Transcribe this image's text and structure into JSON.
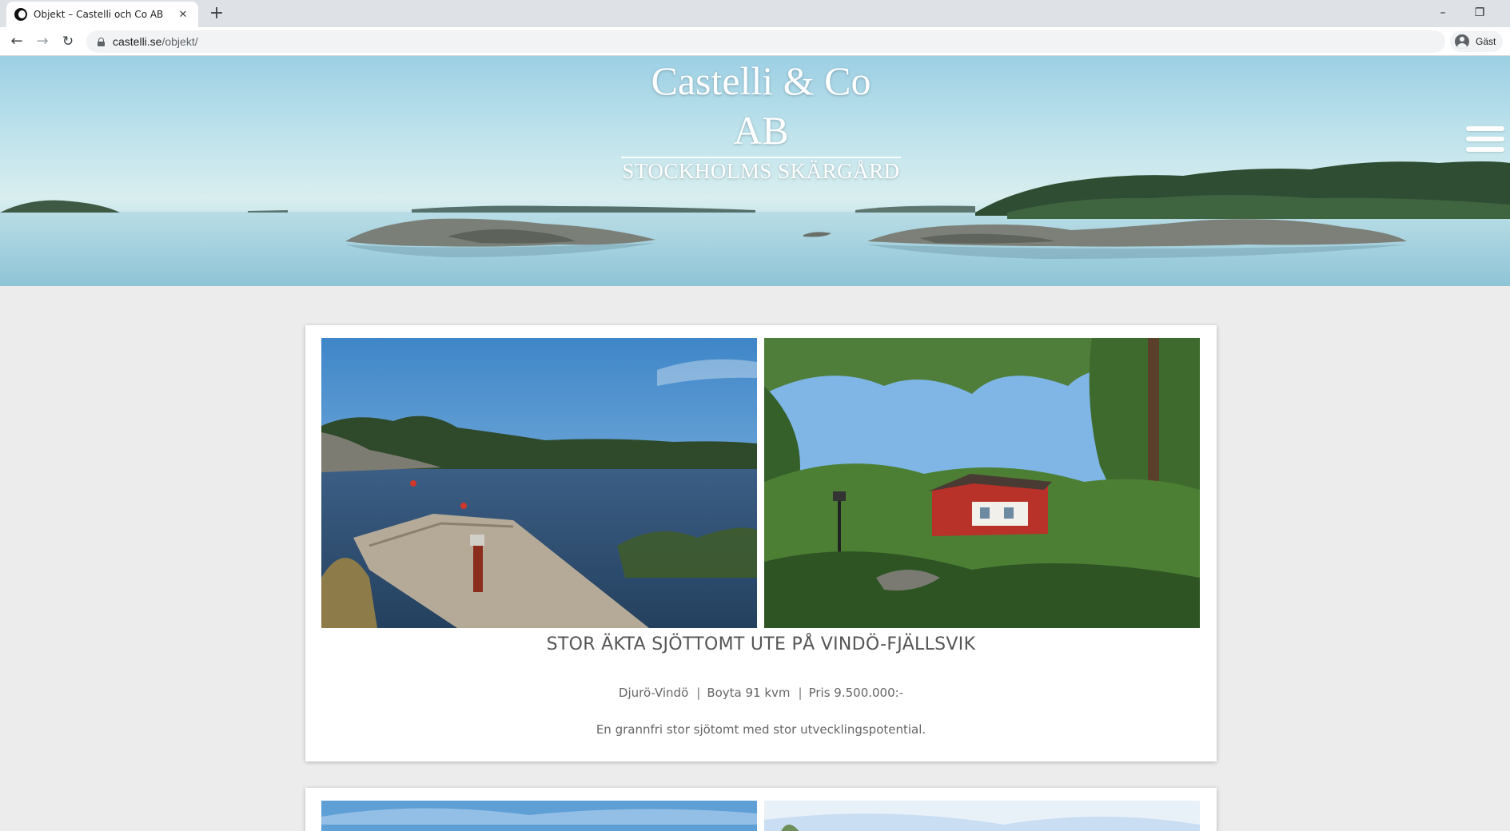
{
  "browser": {
    "tab_title": "Objekt – Castelli och Co AB",
    "tab_close_glyph": "✕",
    "new_tab_glyph": "+",
    "minimize_glyph": "–",
    "restore_glyph": "❐",
    "back_glyph": "←",
    "forward_glyph": "→",
    "reload_glyph": "↻",
    "url_host": "castelli.se",
    "url_path": "/objekt/",
    "profile_label": "Gäst"
  },
  "header": {
    "brand_name": "Castelli & Co AB",
    "brand_subtitle": "STOCKHOLMS SKÄRGÅRD"
  },
  "listings": [
    {
      "title": "STOR ÄKTA SJÖTTOMT UTE PÅ VINDÖ-FJÄLLSVIK",
      "area": "Djurö-Vindö",
      "living_area": "Boyta 91 kvm",
      "price": "Pris 9.500.000:-",
      "description": "En grannfri stor sjötomt med stor utvecklingspotential."
    }
  ],
  "colors": {
    "page_bg": "#ececec",
    "card_bg": "#ffffff",
    "text": "#555555"
  }
}
